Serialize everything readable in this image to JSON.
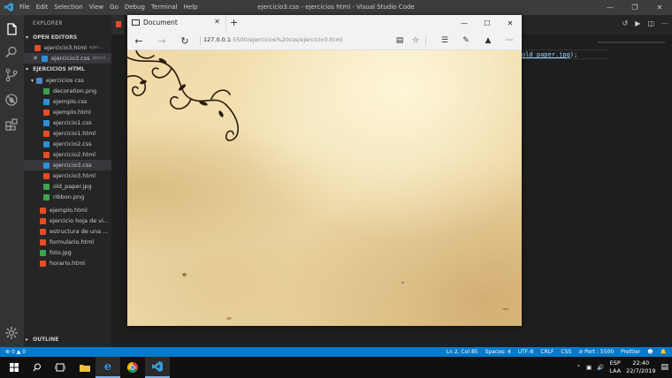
{
  "vscode": {
    "window_title": "ejercicio3.css - ejercicios html - Visual Studio Code",
    "menu": [
      "File",
      "Edit",
      "Selection",
      "View",
      "Go",
      "Debug",
      "Terminal",
      "Help"
    ],
    "explorer_title": "EXPLORER",
    "open_editors_header": "OPEN EDITORS",
    "open_editors": [
      {
        "name": "ejercicio3.html",
        "sub": "ejer..."
      },
      {
        "name": "ejercicio3.css",
        "sub": "ejerci..."
      }
    ],
    "workspace_header": "EJERCICIOS HTML",
    "folder": "ejercicios css",
    "folder_files": [
      "decoration.png",
      "ejemplo.css",
      "ejemplo.html",
      "ejercicio1.css",
      "ejercicio1.html",
      "ejercicio2.css",
      "ejercicio2.html",
      "ejercicio3.css",
      "ejercicio3.html",
      "old_paper.jpg",
      "ribbon.png"
    ],
    "root_files": [
      "ejemplo.html",
      "ejercicio hoja de vi...",
      "estructura de una ...",
      "formulario.html",
      "foto.jpg",
      "horario.html"
    ],
    "outline_header": "OUTLINE",
    "tab_partial_label": "ejer",
    "code_fragment": {
      "link_text": "old_paper.jpg",
      "suffix": ");"
    },
    "status": {
      "errors": "0",
      "warnings": "0",
      "position": "Ln 2, Col 85",
      "spaces": "Spaces: 4",
      "encoding": "UTF-8",
      "eol": "CRLF",
      "language": "CSS",
      "port": "Port : 5500",
      "formatter": "Prettier"
    }
  },
  "browser": {
    "tab_title": "Document",
    "new_tab": "+",
    "url_host": "127.0.0.1",
    "url_rest": ":5500/ejercicios%20css/ejercicio3.html"
  },
  "taskbar": {
    "lang_top": "ESP",
    "lang_bottom": "LAA",
    "time": "22:40",
    "date": "22/7/2019"
  }
}
